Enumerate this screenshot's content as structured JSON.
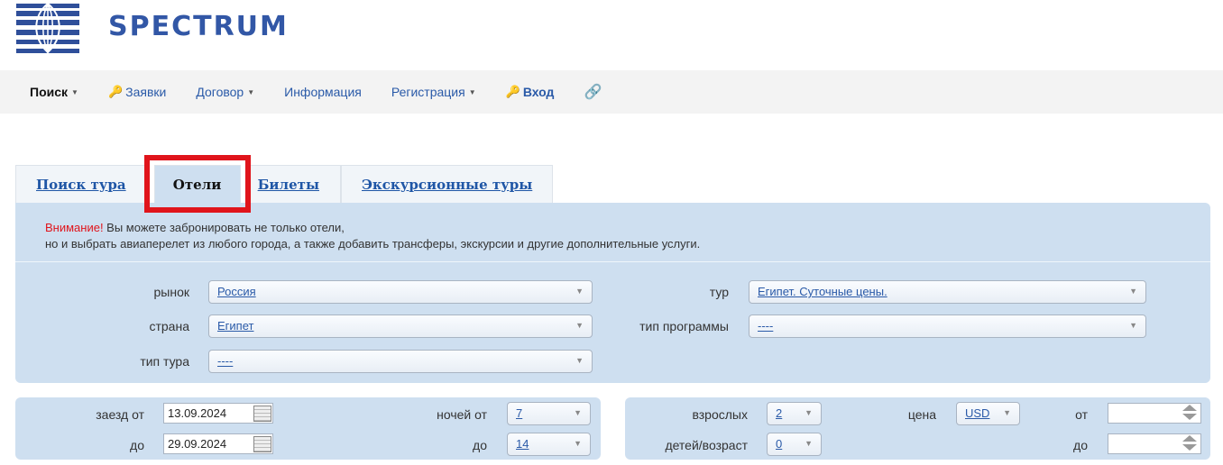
{
  "brand": {
    "name": "SPECTRUM",
    "logo_icon": "spectrum-globe-logo"
  },
  "nav": {
    "items": [
      {
        "label": "Поиск",
        "dropdown": true,
        "active": true
      },
      {
        "label": "Заявки",
        "icon": "key-icon"
      },
      {
        "label": "Договор",
        "dropdown": true
      },
      {
        "label": "Информация"
      },
      {
        "label": "Регистрация",
        "dropdown": true
      },
      {
        "label": "Вход",
        "icon": "key-icon",
        "bold": true
      },
      {
        "label": "",
        "icon": "link-icon"
      }
    ]
  },
  "tabs": [
    {
      "label": "Поиск тура",
      "active": false
    },
    {
      "label": "Отели",
      "active": true,
      "highlighted": true
    },
    {
      "label": "Билеты",
      "active": false
    },
    {
      "label": "Экскурсионные туры",
      "active": false
    }
  ],
  "notice": {
    "warning_word": "Внимание!",
    "line1": " Вы можете забронировать не только отели,",
    "line2": "но и выбрать авиаперелет из любого города, а также добавить трансферы, экскурсии и другие дополнительные услуги."
  },
  "filters": {
    "market": {
      "label": "рынок",
      "value": "Россия"
    },
    "country": {
      "label": "страна",
      "value": "Египет"
    },
    "tour_type": {
      "label": "тип тура",
      "value": "----"
    },
    "tour": {
      "label": "тур",
      "value": "Египет. Суточные цены."
    },
    "program_type": {
      "label": "тип программы",
      "value": "----"
    }
  },
  "dates": {
    "checkin_from": {
      "label": "заезд от",
      "value": "13.09.2024"
    },
    "checkin_to": {
      "label": "до",
      "value": "29.09.2024"
    },
    "nights_from": {
      "label": "ночей от",
      "value": "7"
    },
    "nights_to": {
      "label": "до",
      "value": "14"
    }
  },
  "guests": {
    "adults": {
      "label": "взрослых",
      "value": "2"
    },
    "children": {
      "label": "детей/возраст",
      "value": "0"
    },
    "price": {
      "label": "цена",
      "currency": "USD"
    },
    "price_from": {
      "label": "от",
      "value": ""
    },
    "price_to": {
      "label": "до",
      "value": ""
    }
  },
  "colors": {
    "accent": "#2a5aa8",
    "panel": "#cedff0",
    "highlight": "#e0141b",
    "brand": "#3257a6"
  }
}
